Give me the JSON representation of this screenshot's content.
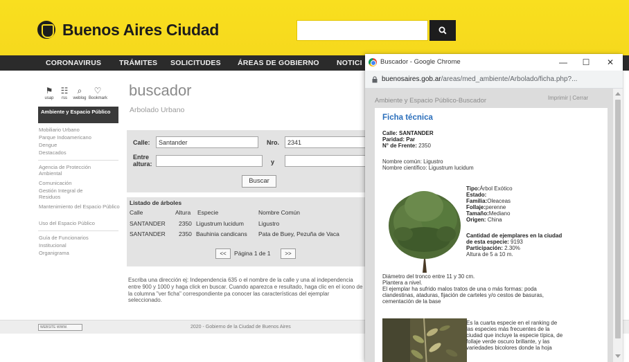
{
  "header": {
    "logo_text": "Buenos Aires Ciudad",
    "search_placeholder": "",
    "search_icon": "magnifier-icon"
  },
  "nav": {
    "items": [
      "CORONAVIRUS",
      "TRÁMITES",
      "SOLICITUDES",
      "ÁREAS DE GOBIERNO",
      "NOTICI"
    ]
  },
  "tools": [
    {
      "icon": "map-icon",
      "label": "usap"
    },
    {
      "icon": "rss-icon",
      "label": "rss"
    },
    {
      "icon": "weblog-icon",
      "label": "weblog"
    },
    {
      "icon": "bookmark-icon",
      "label": "Bookmark"
    }
  ],
  "sidebar": {
    "heading": "Ambiente y Espacio Público",
    "groups": [
      [
        "Mobiliario Urbano",
        "Parque Indoamericano",
        "Dengue",
        "Destacados"
      ],
      [
        "Agencia de Protección Ambiental",
        "Comunicación",
        "Gestión Integral de Residuos",
        "Mantenimiento del Espacio Público",
        "Uso del Espacio Público"
      ],
      [
        "Guía de Funcionarios",
        "Institucional",
        "Organigrama"
      ]
    ]
  },
  "main": {
    "title": "buscador",
    "subtitle": "Arbolado Urbano",
    "form": {
      "calle_label": "Calle:",
      "calle_value": "Santander",
      "nro_label": "Nro.",
      "nro_value": "2341",
      "entre_label": "Entre altura:",
      "y_label": "y",
      "entre_from": "",
      "entre_to": "",
      "buscar_label": "Buscar"
    },
    "listado": {
      "title": "Listado de árboles",
      "headers": [
        "Calle",
        "Altura",
        "Especie",
        "Nombre Común"
      ],
      "rows": [
        [
          "SANTANDER",
          "2350",
          "Ligustrum lucidum",
          "Ligustro"
        ],
        [
          "SANTANDER",
          "2350",
          "Bauhinia candicans",
          "Pata de Buey, Pezuña de Vaca"
        ]
      ],
      "prev_label": "<<",
      "page_text": "Página 1 de 1",
      "next_label": ">>"
    },
    "instructions": "Escriba una dirección ej: Independencia 635 o el nombre de la calle y una al independencia entre 900 y 1000 y haga click en buscar. Cuando aparezca e resultado, haga clic en el icono de la columna \"ver ficha\" correspondiente pa conocer las características del ejemplar seleccionado."
  },
  "footer": {
    "badge": "WEBSITE WWW.",
    "text": "2020 - Gobierno de la Ciudad de Buenos Aires"
  },
  "popup": {
    "window_title": "Buscador - Google Chrome",
    "url_host": "buenosaires.gob.ar",
    "url_path": "/areas/med_ambiente/Arbolado/ficha.php?...",
    "header": "Ambiente y Espacio Público-Buscador",
    "links": "Imprimir | Cerrar",
    "ficha": {
      "title": "Ficha técnica",
      "calle_label": "Calle:",
      "calle": "SANTANDER",
      "paridad_label": "Paridad:",
      "paridad": "Par",
      "frente_label": "N° de Frente:",
      "frente": "2350",
      "nombre_comun": "Nombre común: Ligustro",
      "nombre_cientifico": "Nombre científico: Ligustrum lucidum",
      "tipo_label": "Tipo:",
      "tipo": "Árbol Exótico",
      "estado_label": "Estado:",
      "estado": "",
      "familia_label": "Familia:",
      "familia": "Oleaceas",
      "follaje_label": "Follaje:",
      "follaje": "perenne",
      "tamano_label": "Tamaño:",
      "tamano": "Mediano",
      "origen_label": "Origen:",
      "origen": "China",
      "cantidad_line1": "Cantidad de ejemplares en la ciudad",
      "cantidad_line2": "de esta especie:",
      "cantidad": "9193",
      "participacion_label": "Participación:",
      "participacion": "2.30%",
      "altura": "Altura de 5 a 10 m.",
      "diametro": "Diámetro del tronco entre 11 y 30 cm.",
      "plantera": "Plantera a nivel.",
      "maltrato_1": "El ejemplar ha sufrido malos tratos de una o más formas: poda",
      "maltrato_2": "clandestinas, ataduras, fijación de carteles y/o cestos de basuras,",
      "maltrato_3": "cementación de la base",
      "ranking_1": "Es la cuarta especie en el ranking de",
      "ranking_2": "las especies más frecuentes de la",
      "ranking_3": "ciudad que incluye la especie típica, de",
      "ranking_4": "follaje verde oscuro brillante, y las",
      "ranking_5": "variedades bicolores donde la hoja"
    }
  }
}
